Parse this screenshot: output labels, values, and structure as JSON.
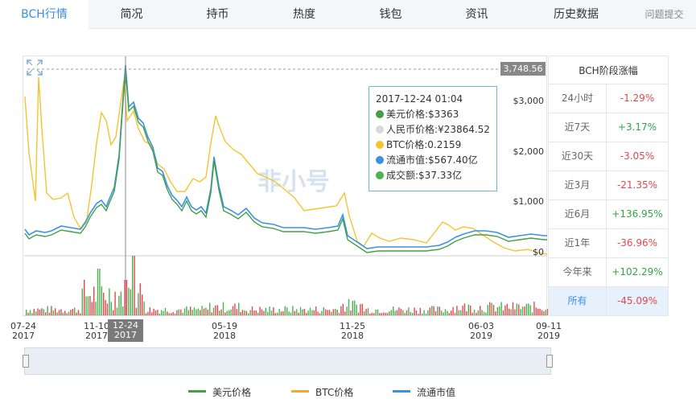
{
  "tabs": [
    {
      "label": "BCH行情",
      "active": true
    },
    {
      "label": "简况"
    },
    {
      "label": "持币"
    },
    {
      "label": "热度"
    },
    {
      "label": "钱包"
    },
    {
      "label": "资讯"
    },
    {
      "label": "历史数据"
    },
    {
      "label": "问题提交"
    }
  ],
  "chart": {
    "max_label": "3,748.56",
    "y_ticks": [
      "$3,000",
      "$2,000",
      "$1,000",
      "$0"
    ],
    "x_labels": [
      {
        "md": "07-24",
        "y": "2017"
      },
      {
        "md": "11-10",
        "y": "2017"
      },
      {
        "md": "12-24",
        "y": "2017"
      },
      {
        "md": "05-19",
        "y": "2018"
      },
      {
        "md": "11-25",
        "y": "2018"
      },
      {
        "md": "06-03",
        "y": "2019"
      },
      {
        "md": "09-11",
        "y": "2019"
      }
    ],
    "watermark": "非小号"
  },
  "tooltip": {
    "time": "2017-12-24 01:04",
    "rows": [
      {
        "text": "美元价格:$3363",
        "color": "#43a047"
      },
      {
        "text": "人民币价格:¥23864.52",
        "color": "#d9d9d9"
      },
      {
        "text": "BTC价格:0.2159",
        "color": "#f4c430"
      },
      {
        "text": "流通市值:$567.40亿",
        "color": "#3b92e3"
      },
      {
        "text": "成交额:$37.33亿",
        "color": "#4caf50"
      }
    ]
  },
  "stage": {
    "title": "BCH阶段涨幅",
    "rows": [
      {
        "label": "24小时",
        "value": "-1.29%",
        "sign": "neg"
      },
      {
        "label": "近7天",
        "value": "+3.17%",
        "sign": "pos"
      },
      {
        "label": "近30天",
        "value": "-3.05%",
        "sign": "neg"
      },
      {
        "label": "近3月",
        "value": "-21.35%",
        "sign": "neg"
      },
      {
        "label": "近6月",
        "value": "+136.95%",
        "sign": "pos"
      },
      {
        "label": "近1年",
        "value": "-36.96%",
        "sign": "neg"
      },
      {
        "label": "今年来",
        "value": "+102.29%",
        "sign": "pos"
      },
      {
        "label": "所有",
        "value": "-45.09%",
        "sign": "neg",
        "selected": true
      }
    ]
  },
  "legend": [
    {
      "label": "美元价格",
      "color": "#43a047"
    },
    {
      "label": "BTC价格",
      "color": "#f0a830"
    },
    {
      "label": "流通市值",
      "color": "#3b92e3"
    }
  ],
  "colors": {
    "accent": "#3a8ee6",
    "usd_line": "#43a047",
    "btc_line": "#f4c430",
    "cap_line": "#3b92e3",
    "vol_up": "#4caf50",
    "vol_down": "#e0484c"
  }
}
